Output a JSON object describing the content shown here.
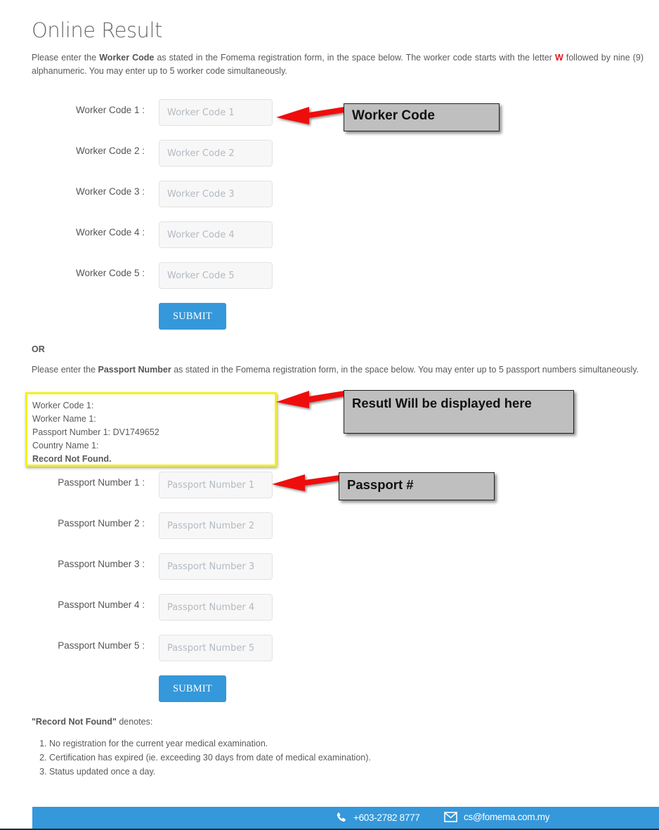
{
  "page": {
    "title": "Online Result"
  },
  "worker_section": {
    "intro": {
      "part1": "Please enter the ",
      "bold": "Worker Code",
      "part2": " as stated in the Fomema registration form, in the space below. The worker code starts with the letter ",
      "letter": "W",
      "part3": " followed by nine (9) alphanumeric. You may enter up to 5 worker code simultaneously."
    },
    "fields": [
      {
        "label": "Worker Code 1 :",
        "placeholder": "Worker Code 1",
        "value": ""
      },
      {
        "label": "Worker Code 2 :",
        "placeholder": "Worker Code 2",
        "value": ""
      },
      {
        "label": "Worker Code 3 :",
        "placeholder": "Worker Code 3",
        "value": ""
      },
      {
        "label": "Worker Code 4 :",
        "placeholder": "Worker Code 4",
        "value": ""
      },
      {
        "label": "Worker Code 5 :",
        "placeholder": "Worker Code 5",
        "value": ""
      }
    ],
    "submit_label": "SUBMIT"
  },
  "or_label": "OR",
  "passport_section": {
    "intro": {
      "part1": "Please enter the ",
      "bold": "Passport Number",
      "part2": " as stated in the Fomema registration form, in the space below. You may enter up to 5 passport numbers simultaneously."
    },
    "result": {
      "lines": [
        "Worker Code 1:",
        "Worker Name 1:",
        "Passport Number 1: DV1749652",
        "Country Name 1:"
      ],
      "status": "Record Not Found."
    },
    "fields": [
      {
        "label": "Passport Number 1 :",
        "placeholder": "Passport Number 1",
        "value": ""
      },
      {
        "label": "Passport Number 2 :",
        "placeholder": "Passport Number 2",
        "value": ""
      },
      {
        "label": "Passport Number 3 :",
        "placeholder": "Passport Number 3",
        "value": ""
      },
      {
        "label": "Passport Number 4 :",
        "placeholder": "Passport Number 4",
        "value": ""
      },
      {
        "label": "Passport Number 5 :",
        "placeholder": "Passport Number 5",
        "value": ""
      }
    ],
    "submit_label": "SUBMIT"
  },
  "annotations": {
    "worker_code": "Worker Code",
    "result": "Resutl Will be displayed here",
    "passport": "Passport #"
  },
  "notes": {
    "title_bold": "\"Record Not Found\"",
    "title_rest": " denotes:",
    "items": [
      "No registration for the current year medical examination.",
      "Certification has expired (ie. exceeding 30 days from date of medical examination).",
      "Status updated once a day."
    ]
  },
  "footer": {
    "phone_icon": "phone-icon",
    "phone": "+603-2782 8777",
    "email_icon": "envelope-icon",
    "email": "cs@fomema.com.my"
  },
  "colors": {
    "accent": "#3498db",
    "highlight_letter": "#e8141b",
    "result_border": "#f4f01e",
    "callout_bg": "#bfbfbf",
    "arrow": "#ee1111"
  }
}
